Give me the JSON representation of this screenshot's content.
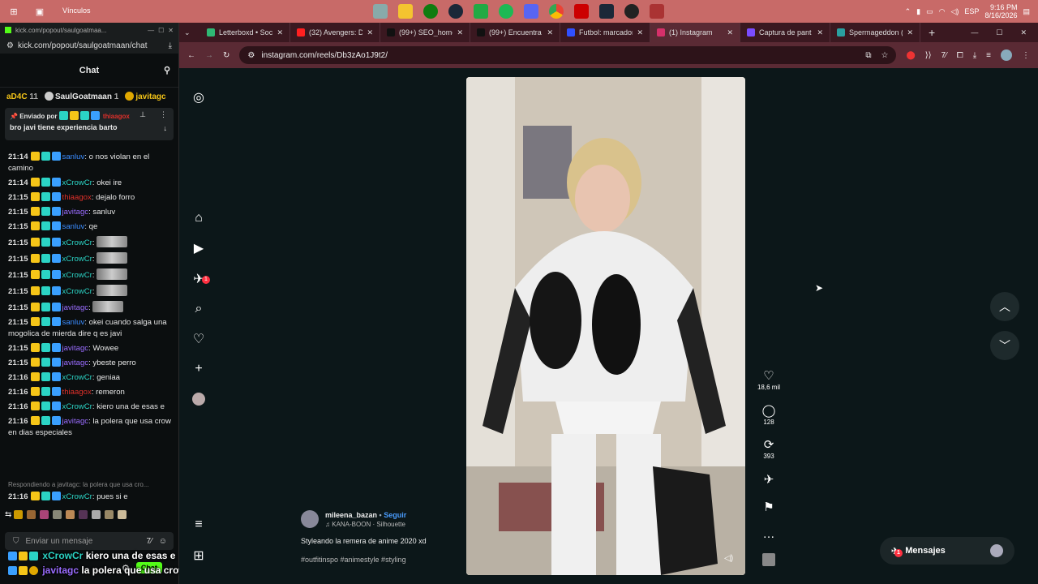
{
  "taskbar": {
    "vinculos_label": "Vínculos",
    "time": "9:16 PM",
    "date": "8/16/2026",
    "lang": "ESP",
    "center_icons": [
      "folder-icon",
      "files-icon",
      "xbox-icon",
      "steam-icon",
      "network-icon",
      "spotify-icon",
      "discord-icon",
      "chrome-icon",
      "app-icon",
      "steam-icon",
      "app2-icon",
      "app3-icon"
    ]
  },
  "chat_window": {
    "tab_title": "kick.com/popout/saulgoatmaa...",
    "url": "kick.com/popout/saulgoatmaan/chat",
    "header": "Chat",
    "gifters": [
      {
        "name": "aD4C",
        "count": "11"
      },
      {
        "name": "SaulGoatmaan",
        "count": "1"
      },
      {
        "name": "javitagc",
        "count": ""
      }
    ],
    "pinned": {
      "label": "Enviado por",
      "by": "thiaagox",
      "text": "bro javi tiene experiencia barto"
    },
    "messages": [
      {
        "time": "21:14",
        "user": "sanluv",
        "color": "#3a8cff",
        "text": "o nos violan en el camino"
      },
      {
        "time": "21:14",
        "user": "xCrowCr",
        "color": "#2bd4c5",
        "text": "okei ire"
      },
      {
        "time": "21:15",
        "user": "thiaagox",
        "color": "#e0302a",
        "text": "dejalo forro"
      },
      {
        "time": "21:15",
        "user": "javitagc",
        "color": "#9a6cff",
        "text": "sanluv"
      },
      {
        "time": "21:15",
        "user": "sanluv",
        "color": "#3a8cff",
        "text": "qe"
      },
      {
        "time": "21:15",
        "user": "xCrowCr",
        "color": "#2bd4c5",
        "text": ""
      },
      {
        "time": "21:15",
        "user": "xCrowCr",
        "color": "#2bd4c5",
        "text": ""
      },
      {
        "time": "21:15",
        "user": "xCrowCr",
        "color": "#2bd4c5",
        "text": ""
      },
      {
        "time": "21:15",
        "user": "xCrowCr",
        "color": "#2bd4c5",
        "text": ""
      },
      {
        "time": "21:15",
        "user": "javitagc",
        "color": "#9a6cff",
        "text": ""
      },
      {
        "time": "21:15",
        "user": "sanluv",
        "color": "#3a8cff",
        "text": "okei cuando salga una mogolica de mierda dire q es javi"
      },
      {
        "time": "21:15",
        "user": "javitagc",
        "color": "#9a6cff",
        "text": "Wowee"
      },
      {
        "time": "21:15",
        "user": "javitagc",
        "color": "#9a6cff",
        "text": "ybeste perro"
      },
      {
        "time": "21:16",
        "user": "xCrowCr",
        "color": "#2bd4c5",
        "text": "geniaa"
      },
      {
        "time": "21:16",
        "user": "thiaagox",
        "color": "#e0302a",
        "text": "remeron"
      },
      {
        "time": "21:16",
        "user": "xCrowCr",
        "color": "#2bd4c5",
        "text": "kiero una de esas e"
      },
      {
        "time": "21:16",
        "user": "javitagc",
        "color": "#9a6cff",
        "text": "la polera que usa crow en dias especiales"
      }
    ],
    "reply_hint": "Respondiendo a javitagc: la polera que usa cro...",
    "last_message": {
      "time": "21:16",
      "user": "xCrowCr",
      "color": "#2bd4c5",
      "text": "pues si e"
    },
    "input_placeholder": "Enviar un mensaje",
    "chat_button": "Chat",
    "overlay": [
      {
        "user": "xCrowCr",
        "color": "#2bd4c5",
        "text": "kiero una de esas e"
      },
      {
        "user": "javitagc",
        "color": "#9a6cff",
        "text": "la polera que usa crow en dias especiales"
      }
    ]
  },
  "browser": {
    "tabs": [
      {
        "label": "Letterboxd • Soci",
        "color": "#2fb874"
      },
      {
        "label": "(32) Avengers: Do",
        "color": "#ff2020"
      },
      {
        "label": "(99+) SEO_homep",
        "color": "#111111"
      },
      {
        "label": "(99+) Encuentra 'c",
        "color": "#111111"
      },
      {
        "label": "Futbol: marcador",
        "color": "#3050ff"
      },
      {
        "label": "(1) Instagram",
        "color": "#d6306a"
      },
      {
        "label": "Captura de pant",
        "color": "#7a4cff"
      },
      {
        "label": "Spermageddon (",
        "color": "#2aa0a0"
      }
    ],
    "url": "instagram.com/reels/Db3zAo1J9t2/"
  },
  "reel": {
    "username": "mileena_bazan",
    "follow": "Seguir",
    "music": "KANA-BOON · Silhouette",
    "caption": "Styleando la remera de anime 2020 xd",
    "hashtags": "#outfitinspo #animestyle #styling",
    "likes": "18,6 mil",
    "comments": "128",
    "reposts": "393"
  },
  "messages_button": "Mensajes",
  "messages_badge": "1",
  "notifications_badge": "1"
}
